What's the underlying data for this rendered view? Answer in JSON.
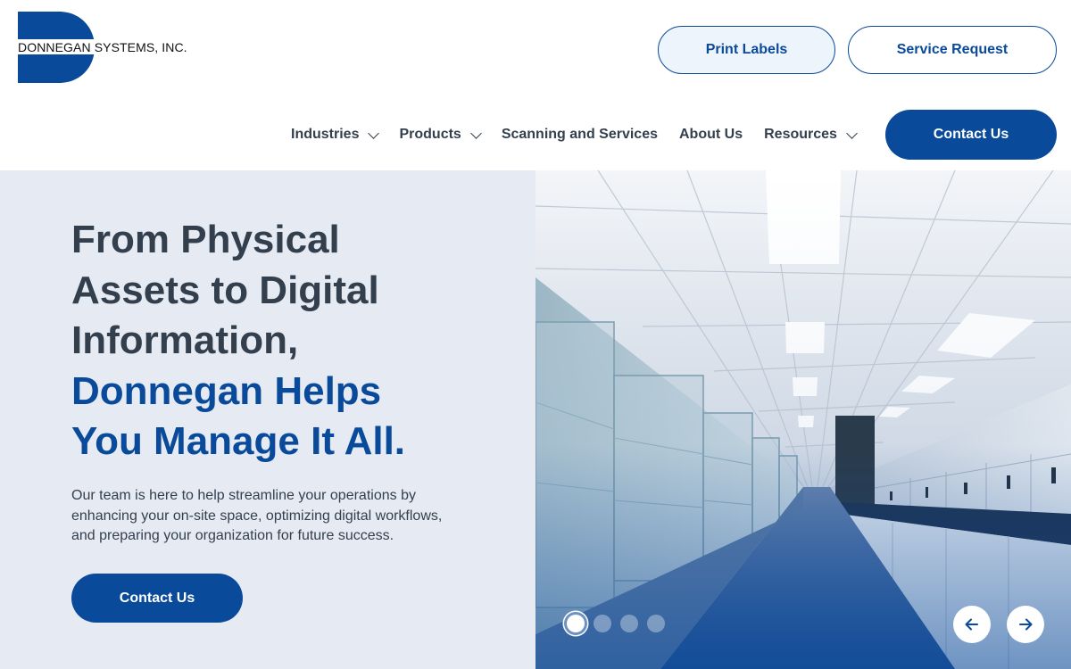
{
  "brand": {
    "name_bold": "DONNEGAN",
    "name_rest": " SYSTEMS, INC.",
    "logo_color": "#0a4a9a"
  },
  "header": {
    "print_labels": "Print Labels",
    "service_request": "Service Request"
  },
  "nav": {
    "items": [
      {
        "label": "Industries",
        "has_dropdown": true
      },
      {
        "label": "Products",
        "has_dropdown": true
      },
      {
        "label": "Scanning and Services",
        "has_dropdown": false
      },
      {
        "label": "About Us",
        "has_dropdown": false
      },
      {
        "label": "Resources",
        "has_dropdown": true
      }
    ],
    "contact": "Contact Us"
  },
  "hero": {
    "headline_line1": "From Physical",
    "headline_line2": "Assets to Digital",
    "headline_line3": "Information,",
    "headline_line4": "Donnegan Helps",
    "headline_line5": "You Manage It All.",
    "body": "Our team is here to help streamline your operations by enhancing your on-site space, optimizing digital workflows, and preparing your organization for future success.",
    "cta": "Contact Us"
  },
  "slider": {
    "slide_count": 4,
    "active_slide": 1,
    "prev_icon": "arrow-left-icon",
    "next_icon": "arrow-right-icon"
  },
  "colors": {
    "primary": "#0a4a9a",
    "text": "#333f4d",
    "hero_bg": "#e6ebf3"
  }
}
